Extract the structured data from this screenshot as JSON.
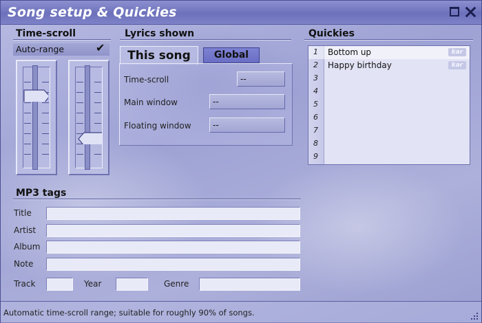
{
  "window": {
    "title": "Song setup & Quickies"
  },
  "time_scroll": {
    "heading": "Time-scroll",
    "auto_range_label": "Auto-range",
    "auto_range_checked": true,
    "check_glyph": "✔"
  },
  "lyrics": {
    "heading": "Lyrics shown",
    "tabs": [
      "This song",
      "Global"
    ],
    "active_tab": "This song",
    "rows": [
      {
        "label": "Time-scroll",
        "value": "--"
      },
      {
        "label": "Main window",
        "value": "--"
      },
      {
        "label": "Floating window",
        "value": "--"
      }
    ]
  },
  "quickies": {
    "heading": "Quickies",
    "numbers": [
      "1",
      "2",
      "3",
      "4",
      "5",
      "6",
      "7",
      "8",
      "9"
    ],
    "items": [
      {
        "title": "Bottom up",
        "badge": "kar"
      },
      {
        "title": "Happy birthday",
        "badge": "kar"
      }
    ]
  },
  "mp3": {
    "heading": "MP3 tags",
    "title_label": "Title",
    "title_value": "",
    "artist_label": "Artist",
    "artist_value": "",
    "album_label": "Album",
    "album_value": "",
    "note_label": "Note",
    "note_value": "",
    "track_label": "Track",
    "track_value": "",
    "year_label": "Year",
    "year_value": "",
    "genre_label": "Genre",
    "genre_value": ""
  },
  "status": {
    "text": "Automatic time-scroll range; suitable for roughly 90% of songs."
  },
  "colors": {
    "titlebar": "#6d71bb",
    "accent_tab": "#7377cb",
    "list_bg": "#e2e3f4"
  }
}
